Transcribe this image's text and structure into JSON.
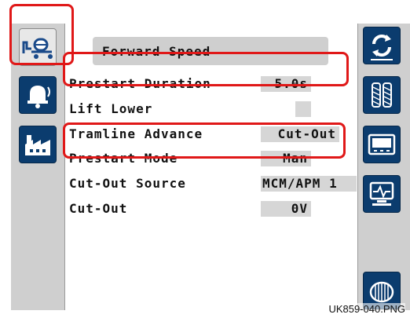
{
  "screen": {
    "title": "Forward Speed",
    "settings": [
      {
        "label": "Prestart Duration",
        "value": "5.0s"
      },
      {
        "label": "Lift Lower",
        "value": ""
      },
      {
        "label": "Tramline Advance",
        "value": "Cut-Out"
      },
      {
        "label": "Prestart Mode",
        "value": "Man"
      },
      {
        "label": "Cut-Out Source",
        "value": "MCM/APM 1"
      },
      {
        "label": "Cut-Out",
        "value": "0V"
      }
    ]
  },
  "left_nav": [
    {
      "icon": "tractor-seeder-icon",
      "state": "active"
    },
    {
      "icon": "alarm-bell-icon",
      "state": "normal"
    },
    {
      "icon": "factory-icon",
      "state": "normal"
    }
  ],
  "right_nav": [
    {
      "icon": "refresh-cycle-icon"
    },
    {
      "icon": "tire-tracks-icon"
    },
    {
      "icon": "display-terminal-icon"
    },
    {
      "icon": "diagnostics-monitor-icon"
    },
    {
      "icon": "seed-drum-icon"
    }
  ],
  "caption": "UK859-040.PNG",
  "colors": {
    "accent": "#0b3c6e",
    "highlight": "#e01818",
    "panel": "#cfcfcf"
  }
}
